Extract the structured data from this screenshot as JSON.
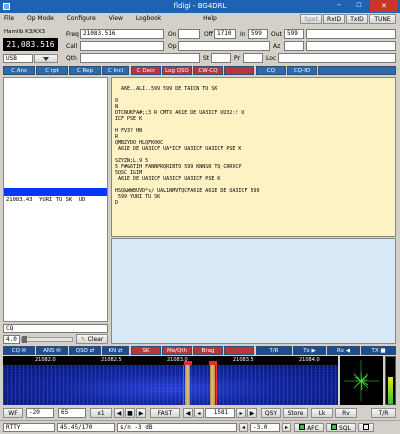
{
  "titlebar": {
    "title": "fldigi - BG4DRL",
    "minimize": "─",
    "maximize": "☐",
    "close": "✕"
  },
  "menu": {
    "items": [
      "File",
      "Op Mode",
      "Configure",
      "View",
      "Logbook",
      "",
      "Help"
    ]
  },
  "top_buttons": {
    "spot": "Spot",
    "rxid": "RxID",
    "txid": "TxID",
    "tune": "TUNE"
  },
  "rig": {
    "name": "Hamlib K3/KX3",
    "freq_display": "21,083.516",
    "mode": "USB"
  },
  "log": {
    "freq_label": "Freq",
    "freq_value": "21083.516",
    "on_label": "On",
    "off_label": "Off",
    "off_value": "1710",
    "in_label": "In",
    "in_value": "599",
    "out_label": "Out",
    "out_value": "599",
    "call_label": "Call",
    "op_label": "Op",
    "az_label": "Az",
    "qth_label": "Qth",
    "st_label": "St",
    "pr_label": "Pr",
    "loc_label": "Loc"
  },
  "macros_top": [
    "C Ans",
    "C rpt",
    "C Rep",
    "C Incl",
    "C Decr",
    "Log QSO",
    "CW-CQ",
    "",
    "CQ",
    "CQ-ID"
  ],
  "browser": {
    "highlight_line": "21083.43  YURI TU SK  UD",
    "filter_text": "CQ",
    "clear_label": "Clear",
    "seek_value": "4.0"
  },
  "rx_text": [
    "",
    "  A6E..ALI..599 599 DE TAICN TU SK",
    "",
    "0",
    "N",
    "DTCNUKFA#;;3 R CMTX A61E DE UA3ICF UU32:! U",
    "ICF PSE K",
    "",
    "H FV3? HN",
    "R",
    "QMBZYDO HLQFK00C",
    " A61E DE UA3ICF UA*ICF UA3ICF UA3ICF PSE K",
    "",
    "SZYZN;L.9 5",
    "5 F#&6TIH FANNPRQRIBTO 599 KNNSR TQ CRRVCP",
    "5QSC IGIM",
    " A61E DE UA3ICF UA3ICF UA3ICF PSE K",
    "",
    "HSQ&WWBUVD*s/ UAL1NMVTQCFA61E A61E DE UA3ICF 599",
    " 599 YURI TU SK",
    "D"
  ],
  "macros_bottom": [
    "CQ",
    "ANS",
    "QSO",
    "KN",
    "SK",
    "Me/Qth",
    "Brag",
    "",
    "T/R",
    "Tx",
    "Rx",
    "TX"
  ],
  "scale": {
    "labels": [
      "21082.0",
      "21082.5",
      "21083.0",
      "21083.5",
      "21084.0"
    ]
  },
  "controls": {
    "wf": "WF",
    "level": "-20",
    "range": "65",
    "zoom": "x1",
    "speed": "FAST",
    "freq": "1581",
    "qsy": "QSY",
    "store": "Store",
    "lk": "Lk",
    "rv": "Rv",
    "tr": "T/R"
  },
  "status": {
    "mode": "RTTY",
    "params": "45.45/170",
    "sn": "s/n  -3  dB",
    "metric": "-3.0",
    "afc": "AFC",
    "sql": "SQL"
  },
  "colors": {
    "macro_blue": "#2f6aa8",
    "macro_red": "#b8353b",
    "rx_bg": "#fdf2c4",
    "tx_bg": "#d8eaf7",
    "waterfall": "#0a1a7a"
  }
}
